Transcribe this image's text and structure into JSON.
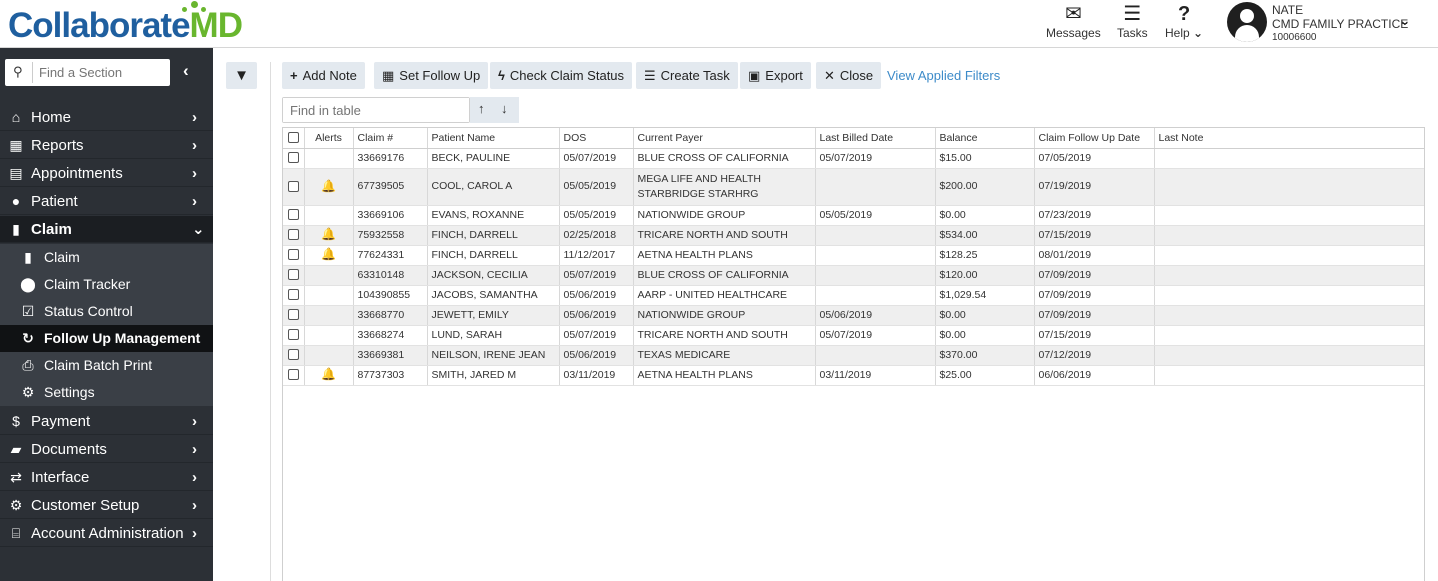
{
  "brand": {
    "part1": "Collaborate",
    "part2": "MD"
  },
  "header": {
    "messages_label": "Messages",
    "tasks_label": "Tasks",
    "help_label": "Help",
    "user_name": "NATE",
    "practice": "CMD FAMILY PRACTICE",
    "account_id": "10006600"
  },
  "sidebar": {
    "search_placeholder": "Find a Section",
    "items": [
      {
        "label": "Home",
        "icon": "home-icon",
        "glyph": "⌂"
      },
      {
        "label": "Reports",
        "icon": "reports-icon",
        "glyph": "▦"
      },
      {
        "label": "Appointments",
        "icon": "calendar-icon",
        "glyph": "▤"
      },
      {
        "label": "Patient",
        "icon": "user-icon",
        "glyph": "●"
      },
      {
        "label": "Claim",
        "icon": "document-icon",
        "glyph": "▮"
      },
      {
        "label": "Payment",
        "icon": "payment-icon",
        "glyph": "$"
      },
      {
        "label": "Documents",
        "icon": "folder-icon",
        "glyph": "▰"
      },
      {
        "label": "Interface",
        "icon": "exchange-icon",
        "glyph": "⇄"
      },
      {
        "label": "Customer Setup",
        "icon": "network-icon",
        "glyph": "⚙"
      },
      {
        "label": "Account Administration",
        "icon": "bank-icon",
        "glyph": "⌸"
      }
    ],
    "claim_subitems": [
      {
        "label": "Claim",
        "icon": "document-icon",
        "glyph": "▮"
      },
      {
        "label": "Claim Tracker",
        "icon": "map-pin-icon",
        "glyph": "⬤"
      },
      {
        "label": "Status Control",
        "icon": "checkbox-icon",
        "glyph": "☑"
      },
      {
        "label": "Follow Up Management",
        "icon": "refresh-icon",
        "glyph": "↻"
      },
      {
        "label": "Claim Batch Print",
        "icon": "printer-icon",
        "glyph": "⎙"
      },
      {
        "label": "Settings",
        "icon": "gear-icon",
        "glyph": "⚙"
      }
    ]
  },
  "toolbar": {
    "add_note": "Add Note",
    "set_follow_up": "Set Follow Up",
    "check_claim_status": "Check Claim Status",
    "create_task": "Create Task",
    "export": "Export",
    "close": "Close",
    "view_filters": "View Applied Filters"
  },
  "table": {
    "find_placeholder": "Find in table",
    "columns": [
      "Alerts",
      "Claim #",
      "Patient Name",
      "DOS",
      "Current Payer",
      "Last Billed Date",
      "Balance",
      "Claim Follow Up Date",
      "Last Note"
    ],
    "rows": [
      {
        "alert": false,
        "claim": "33669176",
        "patient": "BECK, PAULINE",
        "dos": "05/07/2019",
        "payer": "BLUE CROSS OF CALIFORNIA",
        "payer2": "",
        "billed": "05/07/2019",
        "balance": "$15.00",
        "follow": "07/05/2019",
        "note": ""
      },
      {
        "alert": true,
        "claim": "67739505",
        "patient": "COOL, CAROL A",
        "dos": "05/05/2019",
        "payer": "MEGA LIFE AND HEALTH",
        "payer2": "STARBRIDGE STARHRG",
        "billed": "",
        "balance": "$200.00",
        "follow": "07/19/2019",
        "note": ""
      },
      {
        "alert": false,
        "claim": "33669106",
        "patient": "EVANS, ROXANNE",
        "dos": "05/05/2019",
        "payer": "NATIONWIDE GROUP",
        "payer2": "",
        "billed": "05/05/2019",
        "balance": "$0.00",
        "follow": "07/23/2019",
        "note": ""
      },
      {
        "alert": true,
        "claim": "75932558",
        "patient": "FINCH, DARRELL",
        "dos": "02/25/2018",
        "payer": "TRICARE NORTH AND SOUTH",
        "payer2": "",
        "billed": "",
        "balance": "$534.00",
        "follow": "07/15/2019",
        "note": ""
      },
      {
        "alert": true,
        "claim": "77624331",
        "patient": "FINCH, DARRELL",
        "dos": "11/12/2017",
        "payer": "AETNA HEALTH PLANS",
        "payer2": "",
        "billed": "",
        "balance": "$128.25",
        "follow": "08/01/2019",
        "note": ""
      },
      {
        "alert": false,
        "claim": "63310148",
        "patient": "JACKSON, CECILIA",
        "dos": "05/07/2019",
        "payer": "BLUE CROSS OF CALIFORNIA",
        "payer2": "",
        "billed": "",
        "balance": "$120.00",
        "follow": "07/09/2019",
        "note": ""
      },
      {
        "alert": false,
        "claim": "104390855",
        "patient": "JACOBS, SAMANTHA",
        "dos": "05/06/2019",
        "payer": "AARP - UNITED HEALTHCARE",
        "payer2": "",
        "billed": "",
        "balance": "$1,029.54",
        "follow": "07/09/2019",
        "note": ""
      },
      {
        "alert": false,
        "claim": "33668770",
        "patient": "JEWETT, EMILY",
        "dos": "05/06/2019",
        "payer": "NATIONWIDE GROUP",
        "payer2": "",
        "billed": "05/06/2019",
        "balance": "$0.00",
        "follow": "07/09/2019",
        "note": ""
      },
      {
        "alert": false,
        "claim": "33668274",
        "patient": "LUND, SARAH",
        "dos": "05/07/2019",
        "payer": "TRICARE NORTH AND SOUTH",
        "payer2": "",
        "billed": "05/07/2019",
        "balance": "$0.00",
        "follow": "07/15/2019",
        "note": ""
      },
      {
        "alert": false,
        "claim": "33669381",
        "patient": "NEILSON, IRENE JEAN",
        "dos": "05/06/2019",
        "payer": "TEXAS MEDICARE",
        "payer2": "",
        "billed": "",
        "balance": "$370.00",
        "follow": "07/12/2019",
        "note": ""
      },
      {
        "alert": true,
        "claim": "87737303",
        "patient": "SMITH, JARED M",
        "dos": "03/11/2019",
        "payer": "AETNA HEALTH PLANS",
        "payer2": "",
        "billed": "03/11/2019",
        "balance": "$25.00",
        "follow": "06/06/2019",
        "note": ""
      }
    ]
  }
}
